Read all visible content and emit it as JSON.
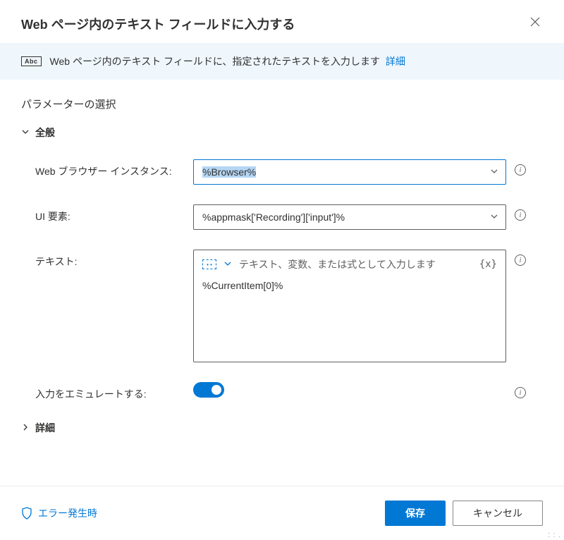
{
  "dialog": {
    "title": "Web ページ内のテキスト フィールドに入力する"
  },
  "banner": {
    "icon_text": "Abc",
    "text": "Web ページ内のテキスト フィールドに、指定されたテキストを入力します",
    "link": "詳細"
  },
  "content": {
    "section_title": "パラメーターの選択",
    "sections": {
      "general": {
        "label": "全般",
        "expanded": true
      },
      "advanced": {
        "label": "詳細",
        "expanded": false
      }
    },
    "fields": {
      "browser": {
        "label": "Web ブラウザー インスタンス:",
        "value": "%Browser%"
      },
      "ui_element": {
        "label": "UI 要素:",
        "value": "%appmask['Recording']['input']%"
      },
      "text": {
        "label": "テキスト:",
        "hint": "テキスト、変数、または式として入力します",
        "value": "%CurrentItem[0]%",
        "var_icon": "{x}"
      },
      "emulate": {
        "label": "入力をエミュレートする:",
        "on": true
      }
    }
  },
  "footer": {
    "error_link": "エラー発生時",
    "save": "保存",
    "cancel": "キャンセル"
  }
}
